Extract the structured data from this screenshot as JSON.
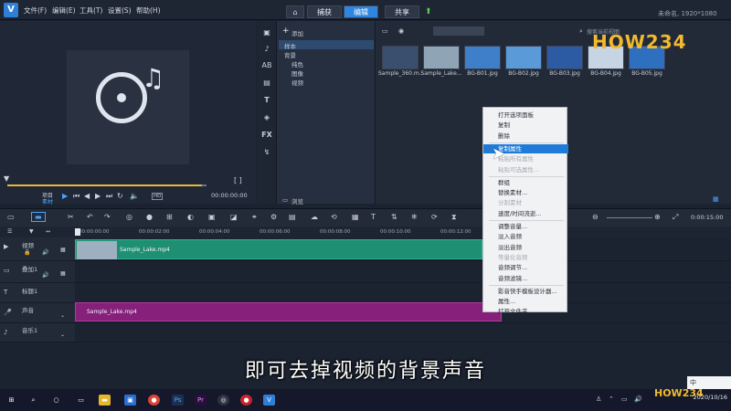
{
  "menu": {
    "file": "文件(F)",
    "edit": "编辑(E)",
    "tools": "工具(T)",
    "settings": "设置(S)",
    "help": "帮助(H)"
  },
  "tabs": {
    "capture": "捕获",
    "edit": "编辑",
    "share": "共享",
    "active": "编辑"
  },
  "project": {
    "title": "未命名, 1920*1080"
  },
  "player": {
    "mode_project": "项目",
    "mode_clip": "素材",
    "timecode_left": "00:00:00:00",
    "timecode_right": "00:00:00:00",
    "hd_badge": "HD"
  },
  "library": {
    "add_label": "添加",
    "tree": [
      "样本",
      "背景",
      "纯色",
      "图像",
      "视频"
    ],
    "browse_label": "浏览",
    "search_placeholder": "搜索当前视图",
    "thumbnails": [
      {
        "label": "Sample_360.m..",
        "color": "#3a4f6e"
      },
      {
        "label": "Sample_Lake...",
        "color": "#8fa5b6"
      },
      {
        "label": "BG-B01.jpg",
        "color": "#3f7fc9"
      },
      {
        "label": "BG-B02.jpg",
        "color": "#5a9ad8"
      },
      {
        "label": "BG-B03.jpg",
        "color": "#2c5aa3"
      },
      {
        "label": "BG-B04.jpg",
        "color": "#c7d4e3"
      },
      {
        "label": "BG-B05.jpg",
        "color": "#2f6fc0"
      }
    ]
  },
  "context_menu": {
    "items": [
      {
        "label": "打开选项面板",
        "state": "normal"
      },
      {
        "label": "复制",
        "state": "normal"
      },
      {
        "label": "删除",
        "state": "normal"
      },
      {
        "label": "复制属性",
        "state": "highlight"
      },
      {
        "label": "粘贴所有属性",
        "state": "disabled"
      },
      {
        "label": "粘贴可选属性...",
        "state": "disabled"
      },
      {
        "label": "群组",
        "state": "normal"
      },
      {
        "label": "替换素材...",
        "state": "normal"
      },
      {
        "label": "分割素材",
        "state": "disabled"
      },
      {
        "label": "速度/时间流逝...",
        "state": "normal"
      },
      {
        "label": "调整音量...",
        "state": "normal"
      },
      {
        "label": "淡入音频",
        "state": "normal"
      },
      {
        "label": "淡出音频",
        "state": "normal"
      },
      {
        "label": "等量化音频",
        "state": "disabled"
      },
      {
        "label": "音频调节...",
        "state": "normal"
      },
      {
        "label": "音频滤镜...",
        "state": "normal"
      },
      {
        "label": "影音快手模板设计器...",
        "state": "normal"
      },
      {
        "label": "属性...",
        "state": "normal"
      },
      {
        "label": "打开文件夹...",
        "state": "normal"
      }
    ]
  },
  "timeline": {
    "ruler": [
      "00:00:00:00",
      "00:00:02:00",
      "00:00:04:00",
      "00:00:06:00",
      "00:00:08:00",
      "00:00:10:00",
      "00:00:12:00",
      "00:00:14:00"
    ],
    "duration": "0:00:15:00",
    "tracks": [
      {
        "label": "视频"
      },
      {
        "label": "叠加1"
      },
      {
        "label": "标题1"
      },
      {
        "label": "声音"
      },
      {
        "label": "音乐1"
      }
    ],
    "video_clip": "Sample_Lake.mp4",
    "audio_clip": "Sample_Lake.mp4"
  },
  "subtitle": "即可去掉视频的背景声音",
  "watermark": "HOW234",
  "taskbar": {
    "date": "2020/10/16",
    "ime": "中"
  }
}
